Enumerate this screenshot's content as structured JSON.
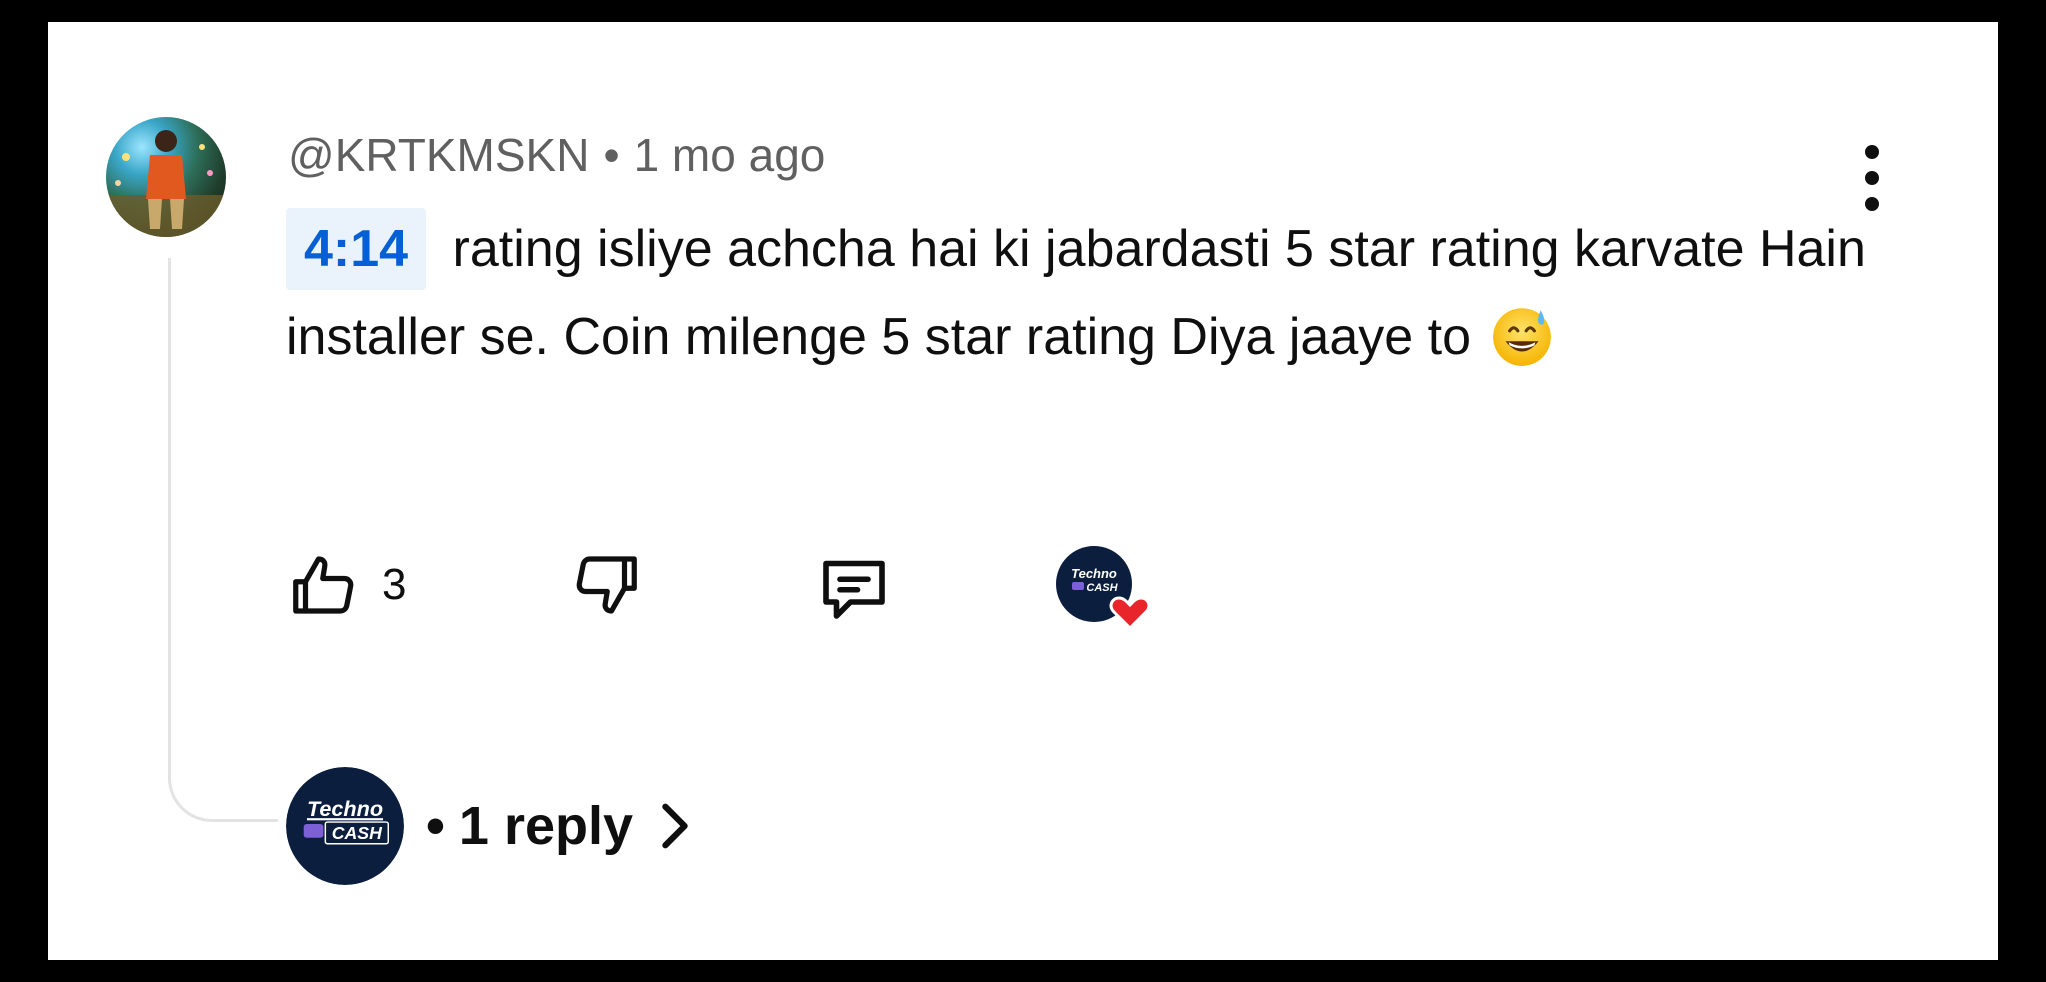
{
  "comment": {
    "author": "@KRTKMSKN",
    "separator": "•",
    "time": "1 mo ago",
    "timestamp_link": "4:14",
    "text_line": "rating isliye achcha hai ki jabardasti 5 star rating karvate Hain installer se. Coin milenge 5 star rating Diya jaaye to",
    "emoji": "grinning-face-with-sweat-emoji"
  },
  "actions": {
    "like_count": "3",
    "icons": [
      "thumbs-up-icon",
      "thumbs-down-icon",
      "reply-icon",
      "creator-heart-badge"
    ]
  },
  "creator": {
    "logo_line1": "Techno",
    "logo_line2": "CASH"
  },
  "replies": {
    "separator": "•",
    "label": "1 reply"
  },
  "colors": {
    "timestamp_bg": "#eaf3fc",
    "timestamp_text": "#065fd4",
    "heart": "#e8252b",
    "logo_bg": "#0b1e3d"
  }
}
